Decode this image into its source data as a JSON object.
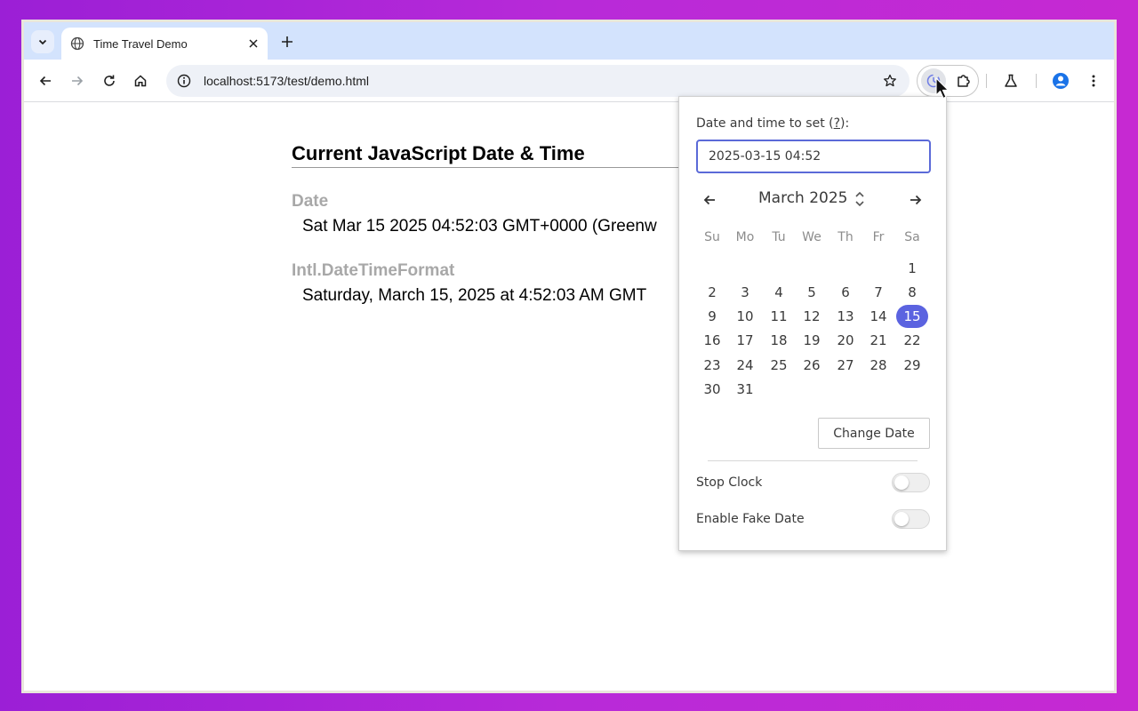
{
  "browser": {
    "tab_title": "Time Travel Demo",
    "url": "localhost:5173/test/demo.html"
  },
  "page": {
    "heading": "Current JavaScript Date & Time",
    "date_label": "Date",
    "date_value": "Sat Mar 15 2025 04:52:03 GMT+0000 (Greenw",
    "intl_label": "Intl.DateTimeFormat",
    "intl_value": "Saturday, March 15, 2025 at 4:52:03 AM GMT"
  },
  "popup": {
    "set_label_prefix": "Date and time to set (",
    "set_label_q": "?",
    "set_label_suffix": "):",
    "date_input_value": "2025-03-15 04:52",
    "month_label": "March 2025",
    "weekdays": [
      "Su",
      "Mo",
      "Tu",
      "We",
      "Th",
      "Fr",
      "Sa"
    ],
    "weeks": [
      [
        "",
        "",
        "",
        "",
        "",
        "",
        "1"
      ],
      [
        "2",
        "3",
        "4",
        "5",
        "6",
        "7",
        "8"
      ],
      [
        "9",
        "10",
        "11",
        "12",
        "13",
        "14",
        "15"
      ],
      [
        "16",
        "17",
        "18",
        "19",
        "20",
        "21",
        "22"
      ],
      [
        "23",
        "24",
        "25",
        "26",
        "27",
        "28",
        "29"
      ],
      [
        "30",
        "31",
        "",
        "",
        "",
        "",
        ""
      ]
    ],
    "selected_day": "15",
    "change_button": "Change Date",
    "stop_clock_label": "Stop Clock",
    "stop_clock_on": false,
    "fake_date_label": "Enable Fake Date",
    "fake_date_on": false,
    "accent_color": "#5b63e0"
  }
}
